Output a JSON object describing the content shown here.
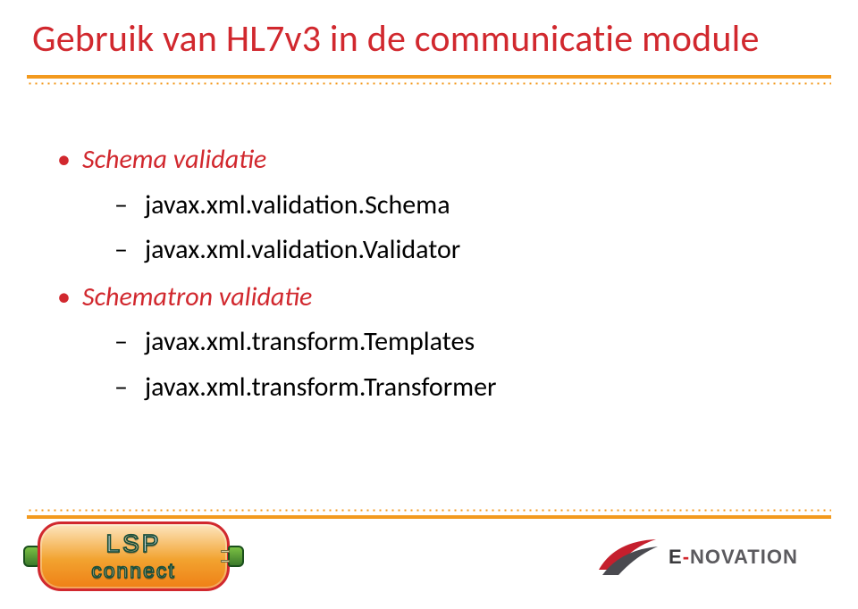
{
  "title": "Gebruik van HL7v3 in de communicatie module",
  "sections": [
    {
      "heading": "Schema validatie",
      "items": [
        "javax.xml.validation.Schema",
        "javax.xml.validation.Validator"
      ]
    },
    {
      "heading": "Schematron validatie",
      "items": [
        "javax.xml.transform.Templates",
        "javax.xml.transform.Transformer"
      ]
    }
  ],
  "logos": {
    "lsp": {
      "line1a": "L",
      "line1b": "S",
      "line1c": "P",
      "line2": "connect"
    },
    "enovation": {
      "prefix": "E",
      "hyphen": "-",
      "rest": "NOVATION"
    }
  }
}
